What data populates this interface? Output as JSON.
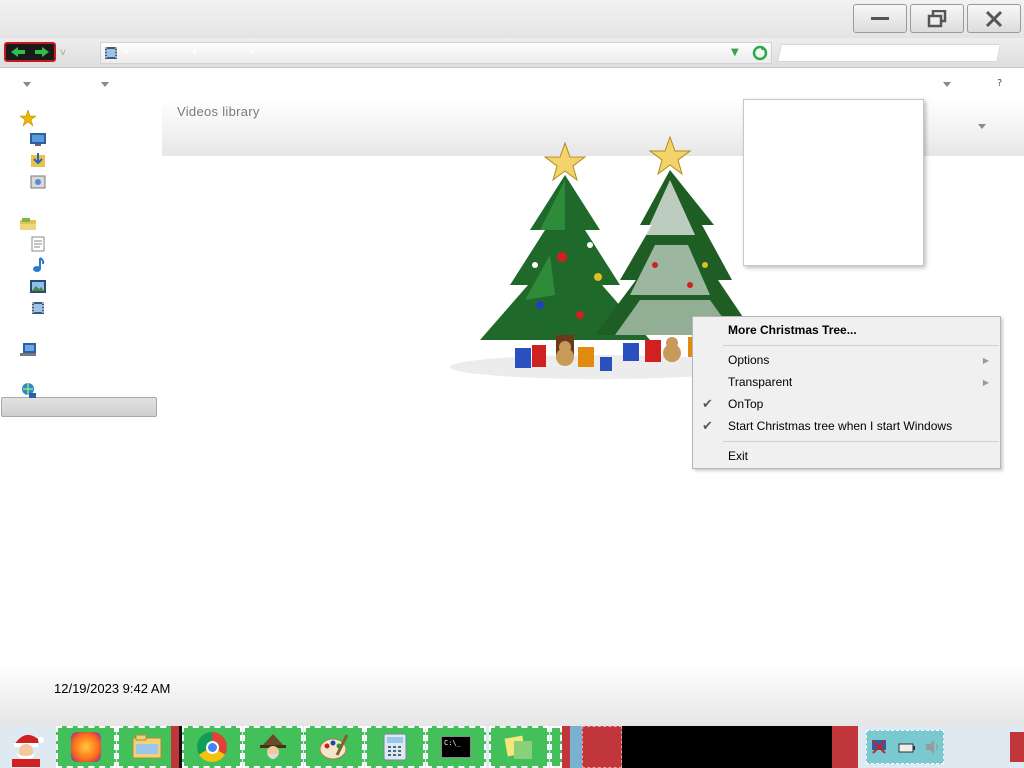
{
  "window": {
    "title": "",
    "library_title": "Videos library",
    "datetime": "12/19/2023 9:42 AM",
    "help_label": "?"
  },
  "context_menu": {
    "items": [
      {
        "label": "More Christmas Tree...",
        "bold": true
      },
      {
        "label": "Options",
        "submenu": true
      },
      {
        "label": "Transparent",
        "submenu": true
      },
      {
        "label": "OnTop",
        "checked": true
      },
      {
        "label": "Start Christmas tree when I start Windows",
        "checked": true
      },
      {
        "label": "Exit"
      }
    ]
  },
  "sidebar": {
    "items": [
      {
        "icon": "favorites-star-icon"
      },
      {
        "icon": "desktop-icon"
      },
      {
        "icon": "downloads-icon"
      },
      {
        "icon": "recent-places-icon"
      },
      {
        "icon": "libraries-icon"
      },
      {
        "icon": "documents-icon"
      },
      {
        "icon": "music-icon"
      },
      {
        "icon": "pictures-icon"
      },
      {
        "icon": "videos-icon",
        "selected": true
      },
      {
        "icon": "computer-icon"
      },
      {
        "icon": "network-icon"
      }
    ]
  },
  "taskbar": {
    "apps": [
      "firefox-icon",
      "file-explorer-icon",
      "chrome-icon",
      "wizard-app-icon",
      "paint-icon",
      "calculator-icon",
      "command-prompt-icon",
      "notes-icon"
    ],
    "command_prompt_text": "C:\\_"
  },
  "colors": {
    "taskbar_tile": "#43c05a",
    "taskbar_red": "#c0363b",
    "menu_bg": "#f0f0f0"
  }
}
